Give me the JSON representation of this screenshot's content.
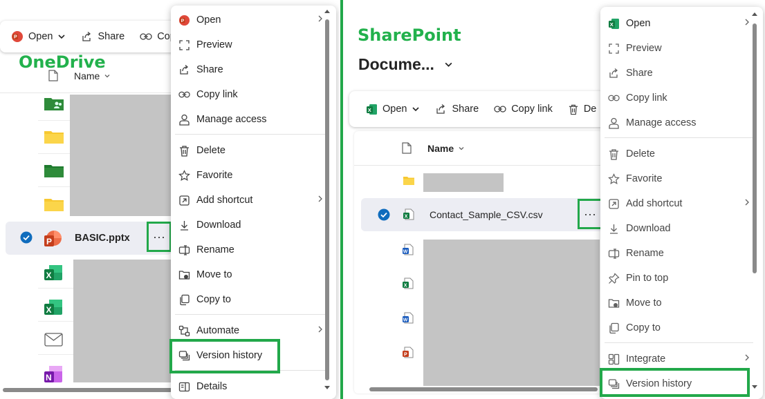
{
  "left": {
    "brand": "OneDrive",
    "toolbar": {
      "open": "Open",
      "share": "Share",
      "copy": "Copy"
    },
    "list": {
      "name_header": "Name",
      "selected_file": "BASIC.pptx"
    },
    "menu": {
      "open": "Open",
      "preview": "Preview",
      "share": "Share",
      "copy_link": "Copy link",
      "manage_access": "Manage access",
      "delete": "Delete",
      "favorite": "Favorite",
      "add_shortcut": "Add shortcut",
      "download": "Download",
      "rename": "Rename",
      "move_to": "Move to",
      "copy_to": "Copy to",
      "automate": "Automate",
      "version_history": "Version history",
      "details": "Details"
    }
  },
  "right": {
    "brand": "SharePoint",
    "library_title": "Docume...",
    "toolbar": {
      "open": "Open",
      "share": "Share",
      "copy_link": "Copy link",
      "delete": "De"
    },
    "list": {
      "name_header": "Name",
      "selected_file": "Contact_Sample_CSV.csv"
    },
    "menu": {
      "open": "Open",
      "preview": "Preview",
      "share": "Share",
      "copy_link": "Copy link",
      "manage_access": "Manage access",
      "delete": "Delete",
      "favorite": "Favorite",
      "add_shortcut": "Add shortcut",
      "download": "Download",
      "rename": "Rename",
      "pin_to_top": "Pin to top",
      "move_to": "Move to",
      "copy_to": "Copy to",
      "integrate": "Integrate",
      "version_history": "Version history"
    }
  },
  "colors": {
    "highlight": "#22a84a",
    "brand": "#22b14c",
    "selection": "#0f6cbd",
    "redacted": "#c4c4c4"
  },
  "icons": [
    "powerpoint-icon",
    "excel-icon",
    "word-icon",
    "onenote-icon",
    "mail-icon",
    "folder-icon",
    "shared-folder-icon",
    "share-icon",
    "link-icon",
    "check-circle-icon",
    "chevron-down-icon",
    "chevron-right-icon",
    "more-icon"
  ]
}
